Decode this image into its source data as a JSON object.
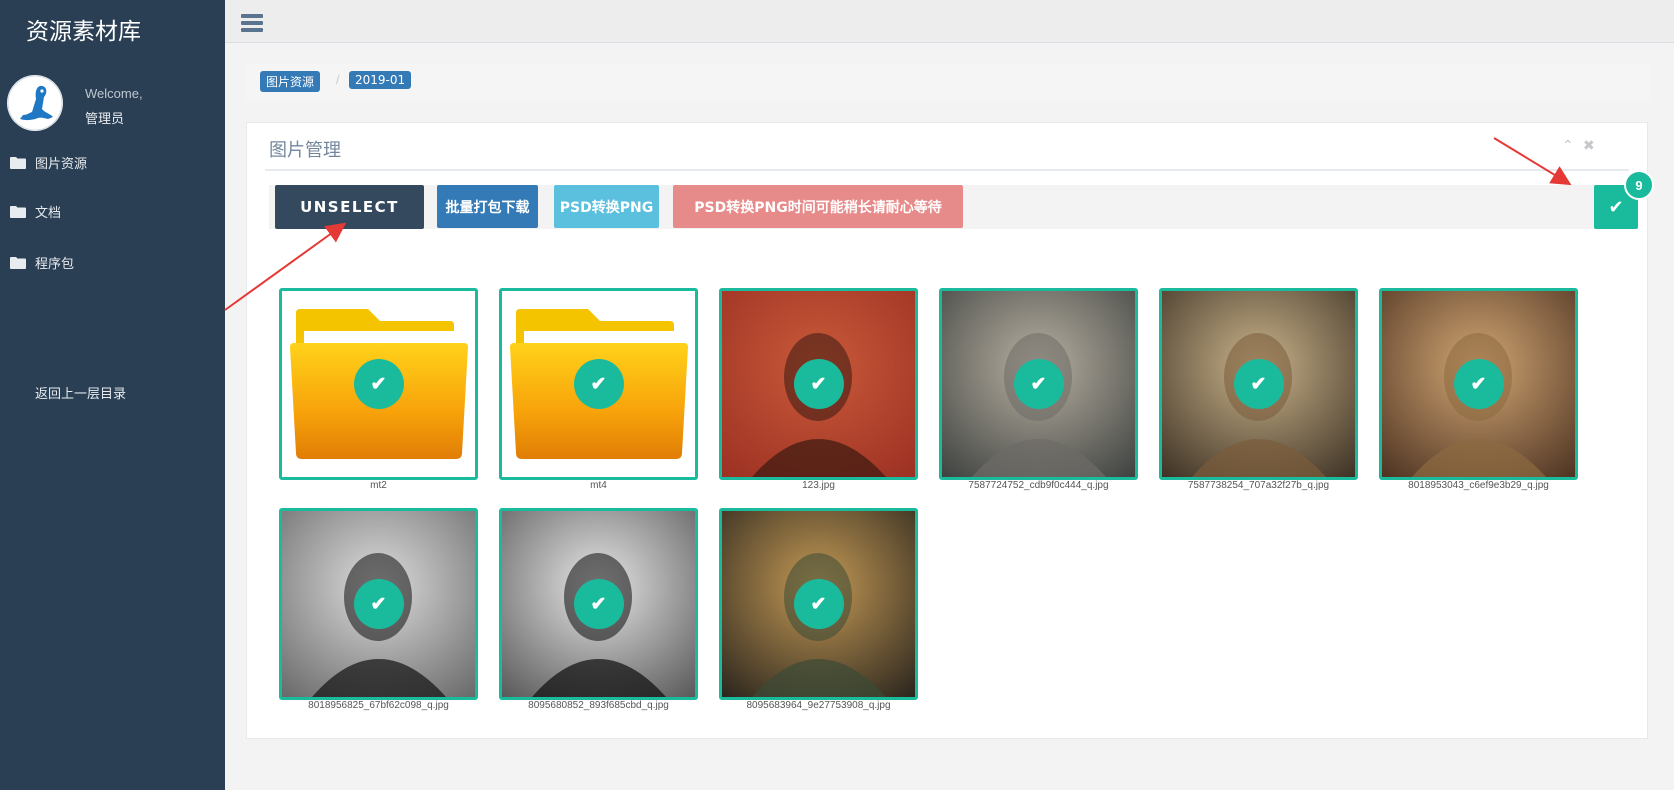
{
  "sidebar": {
    "app_title": "资源素材库",
    "welcome": "Welcome,",
    "username": "管理员",
    "items": [
      {
        "label": "图片资源",
        "icon": "folder-icon"
      },
      {
        "label": "文档",
        "icon": "folder-icon"
      },
      {
        "label": "程序包",
        "icon": "folder-icon"
      }
    ],
    "back_label": "返回上一层目录"
  },
  "breadcrumb": [
    "图片资源",
    "2019-01"
  ],
  "panel": {
    "title": "图片管理"
  },
  "toolbar": {
    "unselect": "UNSELECT",
    "batch_download": "批量打包下载",
    "psd_to_png": "PSD转换PNG",
    "psd_wait": "PSD转换PNG时间可能稍长请耐心等待",
    "selected_count": "9"
  },
  "items": [
    {
      "name": "mt2",
      "type": "folder",
      "selected": true
    },
    {
      "name": "mt4",
      "type": "folder",
      "selected": true
    },
    {
      "name": "123.jpg",
      "type": "image",
      "selected": true
    },
    {
      "name": "7587724752_cdb9f0c444_q.jpg",
      "type": "image",
      "selected": true
    },
    {
      "name": "7587738254_707a32f27b_q.jpg",
      "type": "image",
      "selected": true
    },
    {
      "name": "8018953043_c6ef9e3b29_q.jpg",
      "type": "image",
      "selected": true
    },
    {
      "name": "8018956825_67bf62c098_q.jpg",
      "type": "image",
      "selected": true
    },
    {
      "name": "8095680852_893f685cbd_q.jpg",
      "type": "image",
      "selected": true
    },
    {
      "name": "8095683964_9e27753908_q.jpg",
      "type": "image",
      "selected": true
    }
  ],
  "colors": {
    "accent": "#1abb9c",
    "sidebar": "#2a3f54",
    "primary": "#337ab7",
    "info": "#5bc0de",
    "danger": "#e78a8a"
  }
}
